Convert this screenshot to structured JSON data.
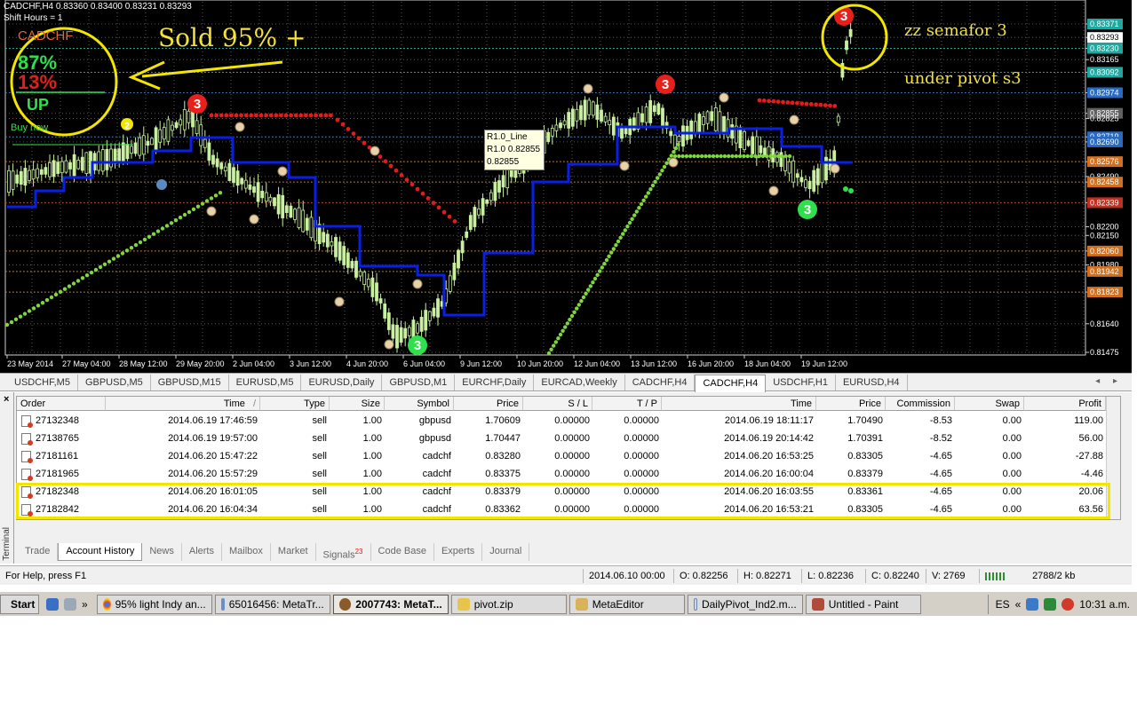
{
  "chart": {
    "header_title": "CADCHF,H4  0.83360 0.83400 0.83231 0.83293",
    "shift_hours": "Shift Hours = 1",
    "indicator": {
      "symbol": "CADCHF",
      "up_pct": "87%",
      "down_pct": "13%",
      "direction": "UP",
      "signal": "Buy now"
    },
    "annotations": {
      "sold": "Sold 95% +",
      "zz": "zz semafor 3",
      "pivot": "under pivot s3"
    },
    "tooltip": [
      "R1.0_Line",
      "R1.0 0.82855",
      "0.82855"
    ],
    "price_labels": [
      "0.83371",
      "0.83293",
      "0.83230",
      "0.83165",
      "0.83092",
      "0.82974",
      "0.82855",
      "0.82825",
      "0.82719",
      "0.82690",
      "0.82576",
      "0.82490",
      "0.82458",
      "0.82339",
      "0.82200",
      "0.82150",
      "0.82060",
      "0.81980",
      "0.81942",
      "0.81823",
      "0.81640",
      "0.81475"
    ],
    "highlighted_prices": [
      "0.83371",
      "0.83293",
      "0.83230",
      "0.83092",
      "0.82974",
      "0.82855",
      "0.82719",
      "0.82690",
      "0.82576",
      "0.82458",
      "0.82339",
      "0.82060",
      "0.81942",
      "0.81823"
    ],
    "date_labels": [
      "23 May 2014",
      "27 May 04:00",
      "28 May 12:00",
      "29 May 20:00",
      "2 Jun 04:00",
      "3 Jun 12:00",
      "4 Jun 20:00",
      "6 Jun 04:00",
      "9 Jun 12:00",
      "10 Jun 20:00",
      "12 Jun 04:00",
      "13 Jun 12:00",
      "16 Jun 20:00",
      "18 Jun 04:00",
      "19 Jun 12:00"
    ],
    "semafor_labels": {
      "red": "3",
      "green": "3",
      "small": "2"
    },
    "colors": {
      "background": "#000000",
      "bull": "#c8f0a0",
      "bear": "#000000",
      "pivot": "#0a1fe6",
      "sar_up": "#7fd63f",
      "sar_down": "#e51a1a"
    }
  },
  "chart_tabs": {
    "items": [
      "USDCHF,M5",
      "GBPUSD,M5",
      "GBPUSD,M15",
      "EURUSD,M5",
      "EURUSD,Daily",
      "GBPUSD,M1",
      "EURCHF,Daily",
      "EURCAD,Weekly",
      "CADCHF,H4",
      "CADCHF,H4",
      "USDCHF,H1",
      "EURUSD,H4"
    ],
    "active_index": 9,
    "scroll": "◂ ▸"
  },
  "terminal": {
    "close": "×",
    "side_label": "Terminal",
    "columns": [
      "Order",
      "Time",
      "Type",
      "Size",
      "Symbol",
      "Price",
      "S / L",
      "T / P",
      "Time",
      "Price",
      "Commission",
      "Swap",
      "Profit"
    ],
    "sort_indicator": "/",
    "rows": [
      {
        "order": "27132348",
        "open_time": "2014.06.19 17:46:59",
        "type": "sell",
        "size": "1.00",
        "symbol": "gbpusd",
        "open_price": "1.70609",
        "sl": "0.00000",
        "tp": "0.00000",
        "close_time": "2014.06.19 18:11:17",
        "close_price": "1.70490",
        "commission": "-8.53",
        "swap": "0.00",
        "profit": "119.00"
      },
      {
        "order": "27138765",
        "open_time": "2014.06.19 19:57:00",
        "type": "sell",
        "size": "1.00",
        "symbol": "gbpusd",
        "open_price": "1.70447",
        "sl": "0.00000",
        "tp": "0.00000",
        "close_time": "2014.06.19 20:14:42",
        "close_price": "1.70391",
        "commission": "-8.52",
        "swap": "0.00",
        "profit": "56.00"
      },
      {
        "order": "27181161",
        "open_time": "2014.06.20 15:47:22",
        "type": "sell",
        "size": "1.00",
        "symbol": "cadchf",
        "open_price": "0.83280",
        "sl": "0.00000",
        "tp": "0.00000",
        "close_time": "2014.06.20 16:53:25",
        "close_price": "0.83305",
        "commission": "-4.65",
        "swap": "0.00",
        "profit": "-27.88"
      },
      {
        "order": "27181965",
        "open_time": "2014.06.20 15:57:29",
        "type": "sell",
        "size": "1.00",
        "symbol": "cadchf",
        "open_price": "0.83375",
        "sl": "0.00000",
        "tp": "0.00000",
        "close_time": "2014.06.20 16:00:04",
        "close_price": "0.83379",
        "commission": "-4.65",
        "swap": "0.00",
        "profit": "-4.46"
      },
      {
        "order": "27182348",
        "open_time": "2014.06.20 16:01:05",
        "type": "sell",
        "size": "1.00",
        "symbol": "cadchf",
        "open_price": "0.83379",
        "sl": "0.00000",
        "tp": "0.00000",
        "close_time": "2014.06.20 16:03:55",
        "close_price": "0.83361",
        "commission": "-4.65",
        "swap": "0.00",
        "profit": "20.06"
      },
      {
        "order": "27182842",
        "open_time": "2014.06.20 16:04:34",
        "type": "sell",
        "size": "1.00",
        "symbol": "cadchf",
        "open_price": "0.83362",
        "sl": "0.00000",
        "tp": "0.00000",
        "close_time": "2014.06.20 16:53:21",
        "close_price": "0.83305",
        "commission": "-4.65",
        "swap": "0.00",
        "profit": "63.56"
      }
    ],
    "tabs": [
      "Trade",
      "Account History",
      "News",
      "Alerts",
      "Mailbox",
      "Market",
      "Signals",
      "Code Base",
      "Experts",
      "Journal"
    ],
    "tabs_active_index": 1,
    "signals_badge": "23"
  },
  "statusbar": {
    "help": "For Help, press F1",
    "datetime": "2014.06.10 00:00",
    "open": "O: 0.82256",
    "high": "H: 0.82271",
    "low": "L: 0.82236",
    "close": "C: 0.82240",
    "volume": "V: 2769",
    "traffic": "2788/2 kb"
  },
  "taskbar": {
    "start": "Start",
    "chevron": "»",
    "items": [
      "95% light Indy an...",
      "65016456: MetaTr...",
      "2007743: MetaT...",
      "pivot.zip",
      "MetaEditor",
      "DailyPivot_Ind2.m...",
      "Untitled - Paint"
    ],
    "active_index": 2,
    "lang": "ES",
    "tray_chevron": "«",
    "clock": "10:31 a.m."
  }
}
